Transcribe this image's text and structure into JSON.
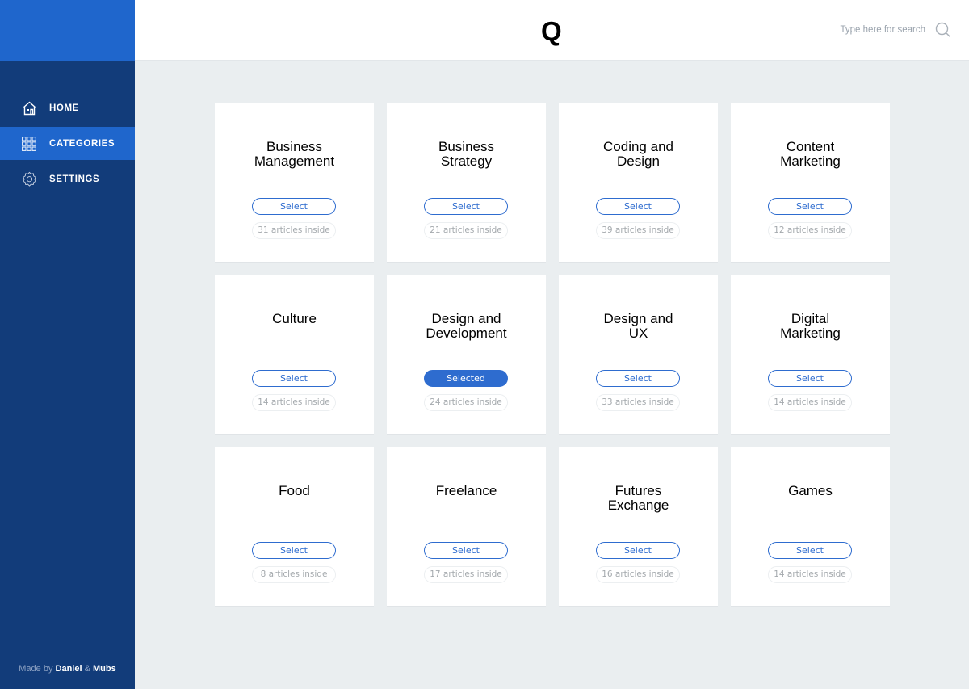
{
  "sidebar": {
    "items": [
      {
        "label": "HOME",
        "icon": "home-icon",
        "active": false
      },
      {
        "label": "CATEGORIES",
        "icon": "grid-icon",
        "active": true
      },
      {
        "label": "SETTINGS",
        "icon": "gear-icon",
        "active": false
      }
    ],
    "footer": {
      "prefix": "Made by ",
      "name1": "Daniel",
      "sep": " & ",
      "name2": "Mubs"
    }
  },
  "header": {
    "logo": "Q",
    "search_placeholder": "Type here for search"
  },
  "colors": {
    "accent": "#2e6ccf",
    "sidebar": "#123c7a",
    "sidebar_active": "#1f66cc"
  },
  "categories": [
    {
      "title": "Business\nManagement",
      "button": "Select",
      "count": "31 articles inside",
      "selected": false
    },
    {
      "title": "Business\nStrategy",
      "button": "Select",
      "count": "21 articles inside",
      "selected": false
    },
    {
      "title": "Coding and\nDesign",
      "button": "Select",
      "count": "39 articles inside",
      "selected": false
    },
    {
      "title": "Content\nMarketing",
      "button": "Select",
      "count": "12 articles inside",
      "selected": false
    },
    {
      "title": "Culture",
      "button": "Select",
      "count": "14 articles inside",
      "selected": false
    },
    {
      "title": "Design and\nDevelopment",
      "button": "Selected",
      "count": "24 articles inside",
      "selected": true
    },
    {
      "title": "Design and\nUX",
      "button": "Select",
      "count": "33 articles inside",
      "selected": false
    },
    {
      "title": "Digital\nMarketing",
      "button": "Select",
      "count": "14 articles inside",
      "selected": false
    },
    {
      "title": "Food",
      "button": "Select",
      "count": "8 articles inside",
      "selected": false
    },
    {
      "title": "Freelance",
      "button": "Select",
      "count": "17 articles inside",
      "selected": false
    },
    {
      "title": "Futures\nExchange",
      "button": "Select",
      "count": "16 articles inside",
      "selected": false
    },
    {
      "title": "Games",
      "button": "Select",
      "count": "14 articles inside",
      "selected": false
    }
  ]
}
